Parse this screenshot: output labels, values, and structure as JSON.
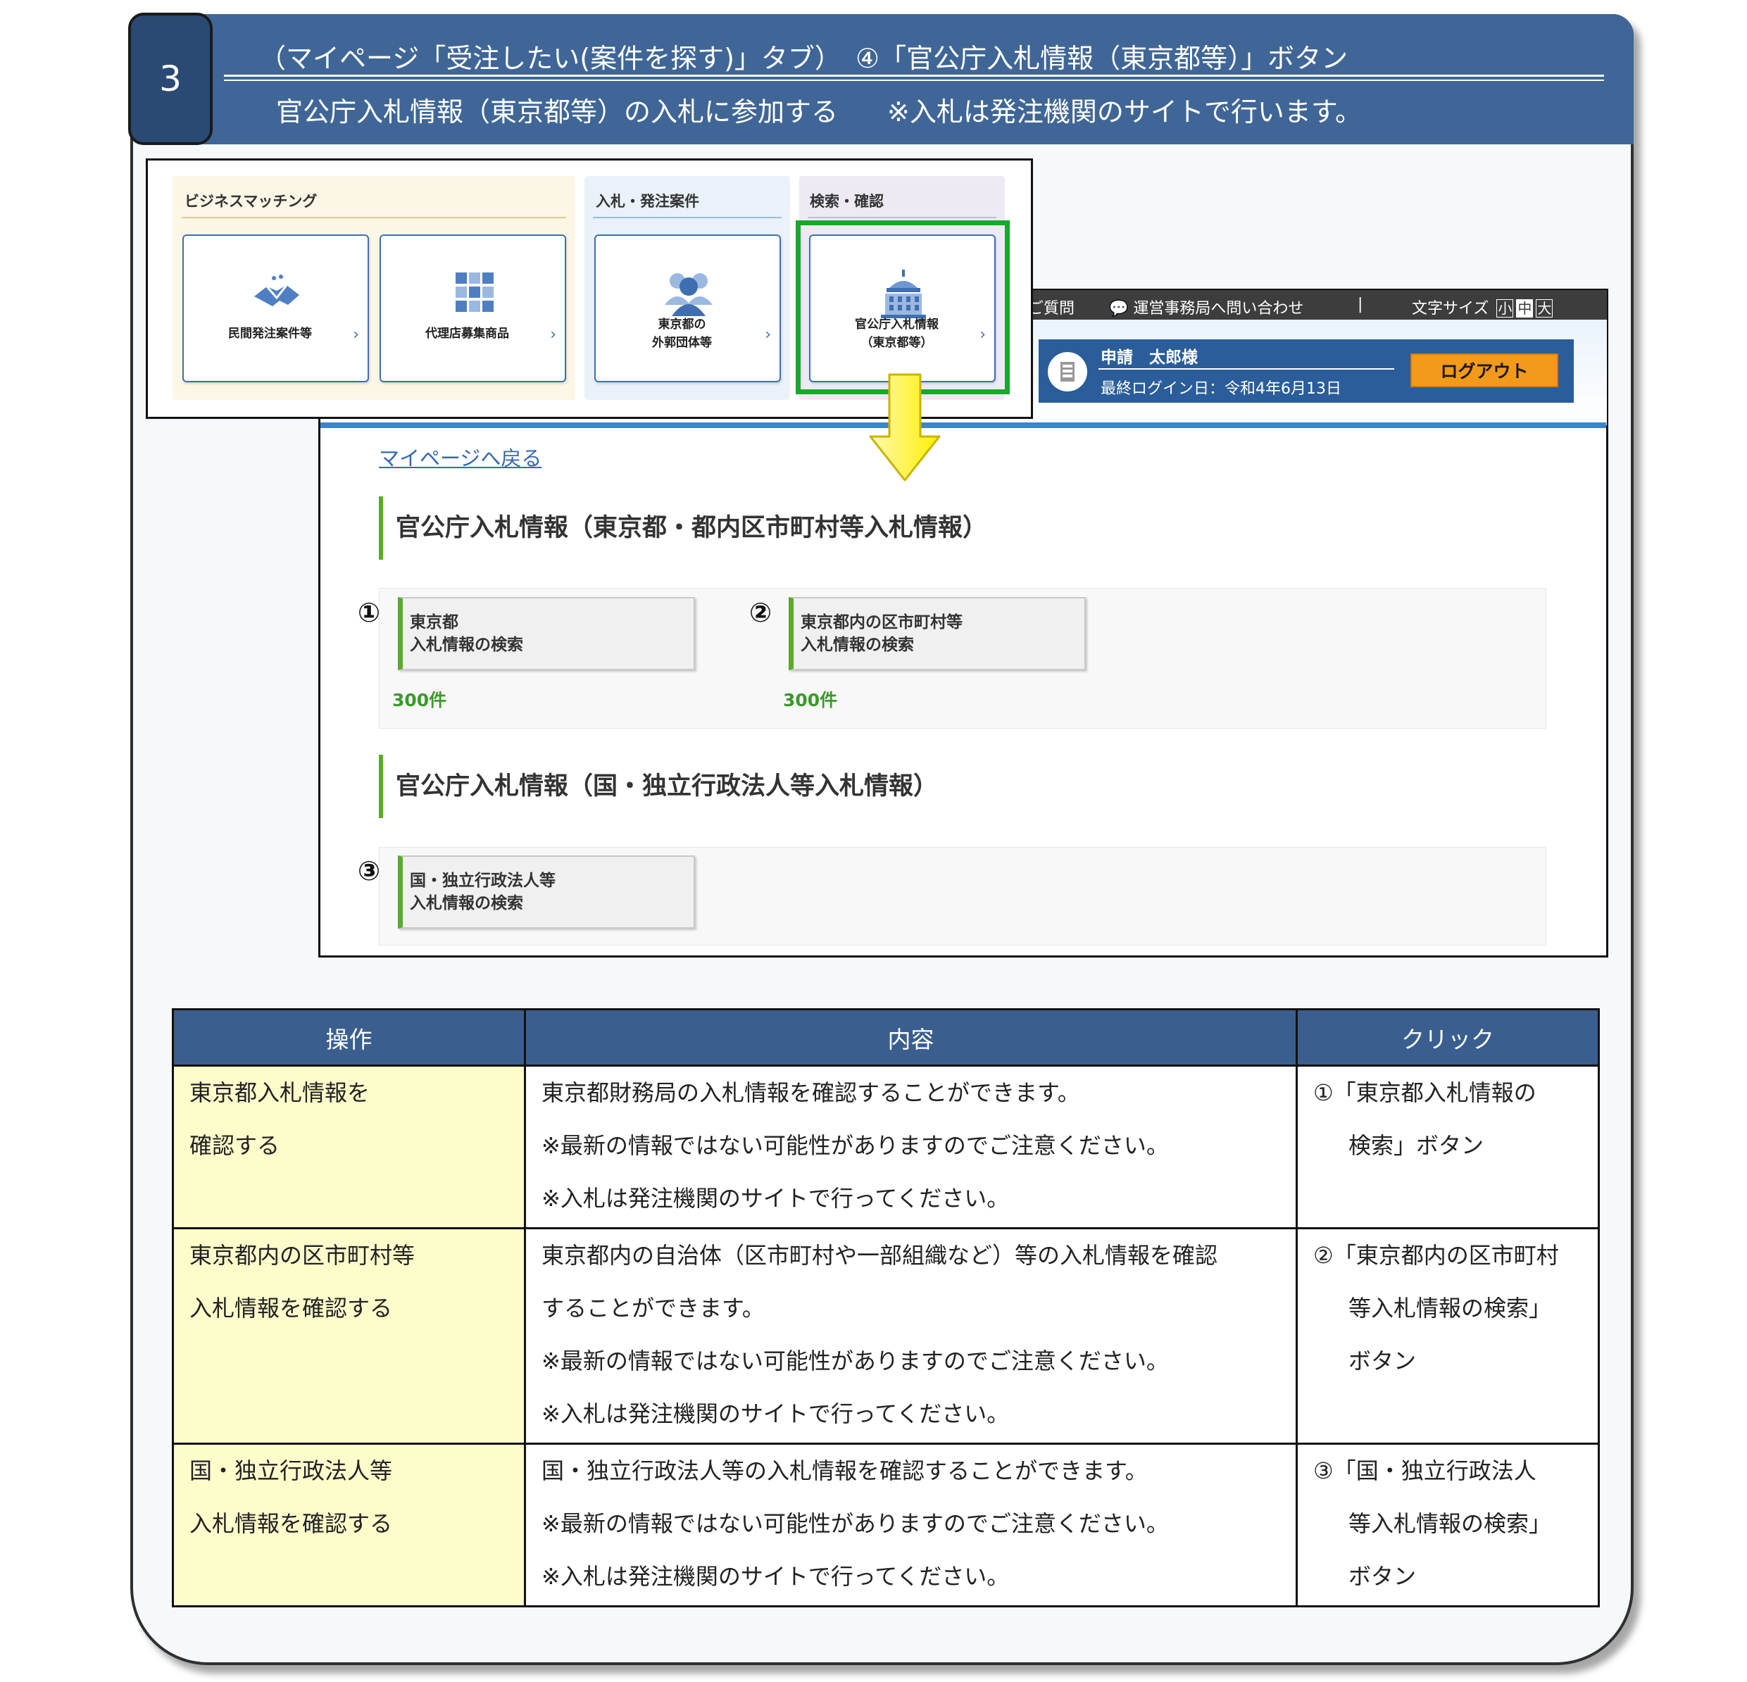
{
  "header": {
    "step": "3",
    "line1_left": "（マイページ「受注したい(案件を探す)」タブ）",
    "line1_right": "④「官公庁入札情報（東京都等）」ボタン",
    "line2_left": "官公庁入札情報（東京都等）の入札に参加する",
    "line2_right": "※入札は発注機関のサイトで行います。"
  },
  "tabs_screenshot": {
    "groups": {
      "business": "ビジネスマッチング",
      "bids": "入札・発注案件",
      "search": "検索・確認"
    },
    "cards": {
      "private": "民間発注案件等",
      "agency": "代理店募集商品",
      "external_1": "東京都の",
      "external_2": "外郭団体等",
      "govt_1": "官公庁入札情報",
      "govt_2": "（東京都等）",
      "chevron": "›"
    }
  },
  "bid_page": {
    "topbar": {
      "faq": "ご質問",
      "contact": "運営事務局へ問い合わせ",
      "separator": "|",
      "font_size": "文字サイズ",
      "size_small": "小",
      "size_mid": "中",
      "size_large": "大"
    },
    "user": {
      "name": "申請　太郎様",
      "last_login": "最終ログイン日：令和4年6月13日",
      "logout": "ログアウト"
    },
    "back_link": "マイページへ戻る",
    "section_tokyo": "官公庁入札情報（東京都・都内区市町村等入札情報）",
    "section_national": "官公庁入札情報（国・独立行政法人等入札情報）",
    "buttons": {
      "tokyo_1": "東京都",
      "tokyo_2": "入札情報の検索",
      "municipal_1": "東京都内の区市町村等",
      "municipal_2": "入札情報の検索",
      "national_1": "国・独立行政法人等",
      "national_2": "入札情報の検索"
    },
    "counts": {
      "tokyo": "300件",
      "municipal": "300件"
    },
    "markers": {
      "one": "①",
      "two": "②",
      "three": "③"
    }
  },
  "table": {
    "headers": [
      "操作",
      "内容",
      "クリック"
    ],
    "rows": [
      {
        "op": [
          "東京都入札情報を",
          "確認する"
        ],
        "content": [
          "東京都財務局の入札情報を確認することができます。",
          "※最新の情報ではない可能性がありますのでご注意ください。",
          "※入札は発注機関のサイトで行ってください。"
        ],
        "click": [
          "①「東京都入札情報の",
          "検索」ボタン"
        ]
      },
      {
        "op": [
          "東京都内の区市町村等",
          "入札情報を確認する"
        ],
        "content": [
          "東京都内の自治体（区市町村や一部組織など）等の入札情報を確認",
          "することができます。",
          "※最新の情報ではない可能性がありますのでご注意ください。",
          "※入札は発注機関のサイトで行ってください。"
        ],
        "click": [
          "②「東京都内の区市町村",
          "等入札情報の検索」",
          "ボタン"
        ]
      },
      {
        "op": [
          "国・独立行政法人等",
          "入札情報を確認する"
        ],
        "content": [
          "国・独立行政法人等の入札情報を確認することができます。",
          "※最新の情報ではない可能性がありますのでご注意ください。",
          "※入札は発注機関のサイトで行ってください。"
        ],
        "click": [
          "③「国・独立行政法人",
          "等入札情報の検索」",
          "ボタン"
        ]
      }
    ]
  },
  "colors": {
    "header_blue": "#3f6696",
    "highlight_green": "#17a82c",
    "accent_green": "#5aaa2c",
    "logout_orange": "#f39a1a",
    "arrow_yellow": "#fff45a"
  }
}
